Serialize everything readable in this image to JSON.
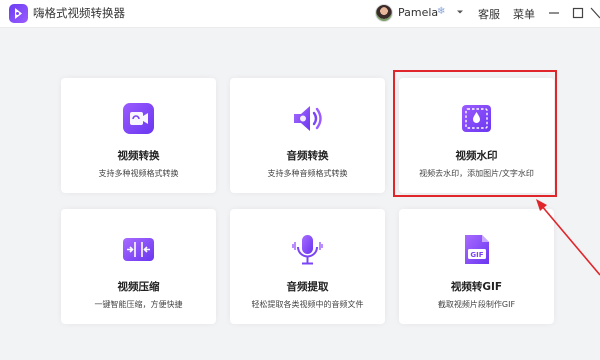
{
  "app": {
    "title": "嗨格式视频转换器"
  },
  "user": {
    "name": "Pamela"
  },
  "titlebar": {
    "service_label": "客服",
    "menu_label": "菜单"
  },
  "cards": [
    {
      "title": "视频转换",
      "desc": "支持多种视频格式转换",
      "icon": "video-convert-icon"
    },
    {
      "title": "音频转换",
      "desc": "支持多种音频格式转换",
      "icon": "audio-convert-icon"
    },
    {
      "title": "视频水印",
      "desc": "视频去水印，添加图片/文字水印",
      "icon": "video-watermark-icon"
    },
    {
      "title": "视频压缩",
      "desc": "一键智能压缩，方便快捷",
      "icon": "video-compress-icon"
    },
    {
      "title": "音频提取",
      "desc": "轻松提取各类视频中的音频文件",
      "icon": "audio-extract-icon"
    },
    {
      "title": "视频转GIF",
      "desc": "截取视频片段制作GIF",
      "icon": "video-gif-icon"
    }
  ],
  "colors": {
    "accent": "#7b45f5",
    "highlight": "#e0262b"
  }
}
